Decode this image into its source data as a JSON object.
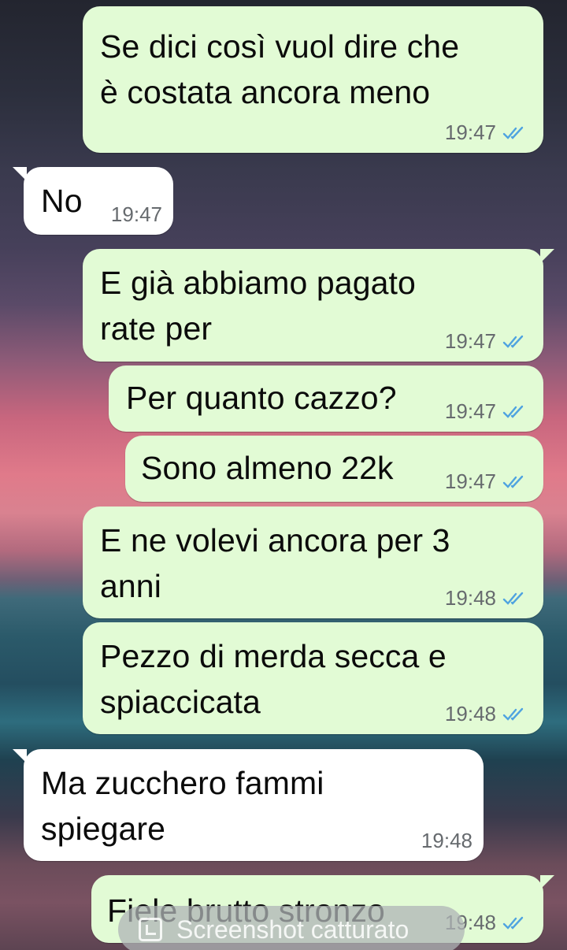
{
  "messages": [
    {
      "id": "m1",
      "direction": "out",
      "text_lines": [
        "Se dici così vuol dire che",
        "è costata ancora meno"
      ],
      "time": "19:47",
      "status": "read"
    },
    {
      "id": "m2",
      "direction": "in",
      "text_lines": [
        "No"
      ],
      "time": "19:47"
    },
    {
      "id": "m3",
      "direction": "out",
      "text_lines": [
        "E già abbiamo pagato",
        "rate per"
      ],
      "time": "19:47",
      "status": "read"
    },
    {
      "id": "m4",
      "direction": "out",
      "text_lines": [
        "Per quanto cazzo?"
      ],
      "time": "19:47",
      "status": "read"
    },
    {
      "id": "m5",
      "direction": "out",
      "text_lines": [
        "Sono almeno 22k"
      ],
      "time": "19:47",
      "status": "read"
    },
    {
      "id": "m6",
      "direction": "out",
      "text_lines": [
        "E ne volevi ancora per 3",
        "anni"
      ],
      "time": "19:48",
      "status": "read"
    },
    {
      "id": "m7",
      "direction": "out",
      "text_lines": [
        "Pezzo di merda secca e",
        "spiaccicata"
      ],
      "time": "19:48",
      "status": "read"
    },
    {
      "id": "m8",
      "direction": "in",
      "text_lines": [
        "Ma zucchero fammi",
        "spiegare"
      ],
      "time": "19:48"
    },
    {
      "id": "m9",
      "direction": "out",
      "text_lines": [
        "Fiele brutto stronzo"
      ],
      "time": "19:48",
      "status": "read"
    }
  ],
  "toast": {
    "text": "Screenshot catturato",
    "icon": "screenshot-icon"
  },
  "colors": {
    "outgoing_bubble": "#e2fbd5",
    "incoming_bubble": "#ffffff",
    "read_ticks": "#4fa3e0",
    "time_text": "#666a6e"
  }
}
